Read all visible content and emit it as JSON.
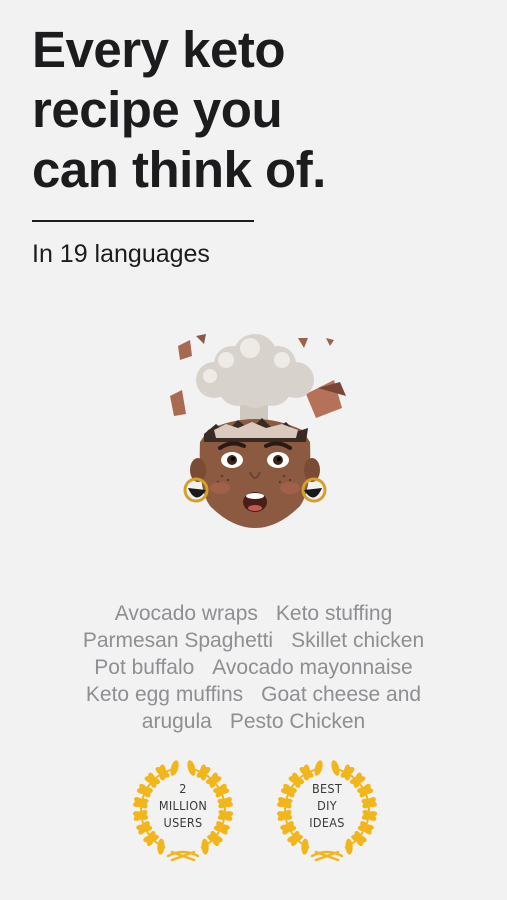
{
  "headline": {
    "line1": "Every keto",
    "line2": "recipe you",
    "line3": "can think of."
  },
  "subtitle": "In 19 languages",
  "illustration": {
    "icon": "mind-blown-memoji"
  },
  "recipes": {
    "lines": [
      [
        "Avocado wraps",
        "Keto stuffing"
      ],
      [
        "Parmesan Spaghetti",
        "Skillet chicken"
      ],
      [
        "Pot buffalo",
        "Avocado mayonnaise"
      ],
      [
        "Keto egg muffins",
        "Goat cheese and"
      ],
      [
        "arugula",
        "Pesto Chicken"
      ]
    ]
  },
  "awards": [
    {
      "icon": "laurel-wreath-icon",
      "lines": [
        "2",
        "MILLION",
        "USERS"
      ]
    },
    {
      "icon": "laurel-wreath-icon",
      "lines": [
        "BEST",
        "DIY",
        "IDEAS"
      ]
    }
  ],
  "colors": {
    "laurel": "#f2b51a",
    "text": "#1c1c1e",
    "muted": "#8e8e93",
    "background": "#f2f2f2"
  }
}
